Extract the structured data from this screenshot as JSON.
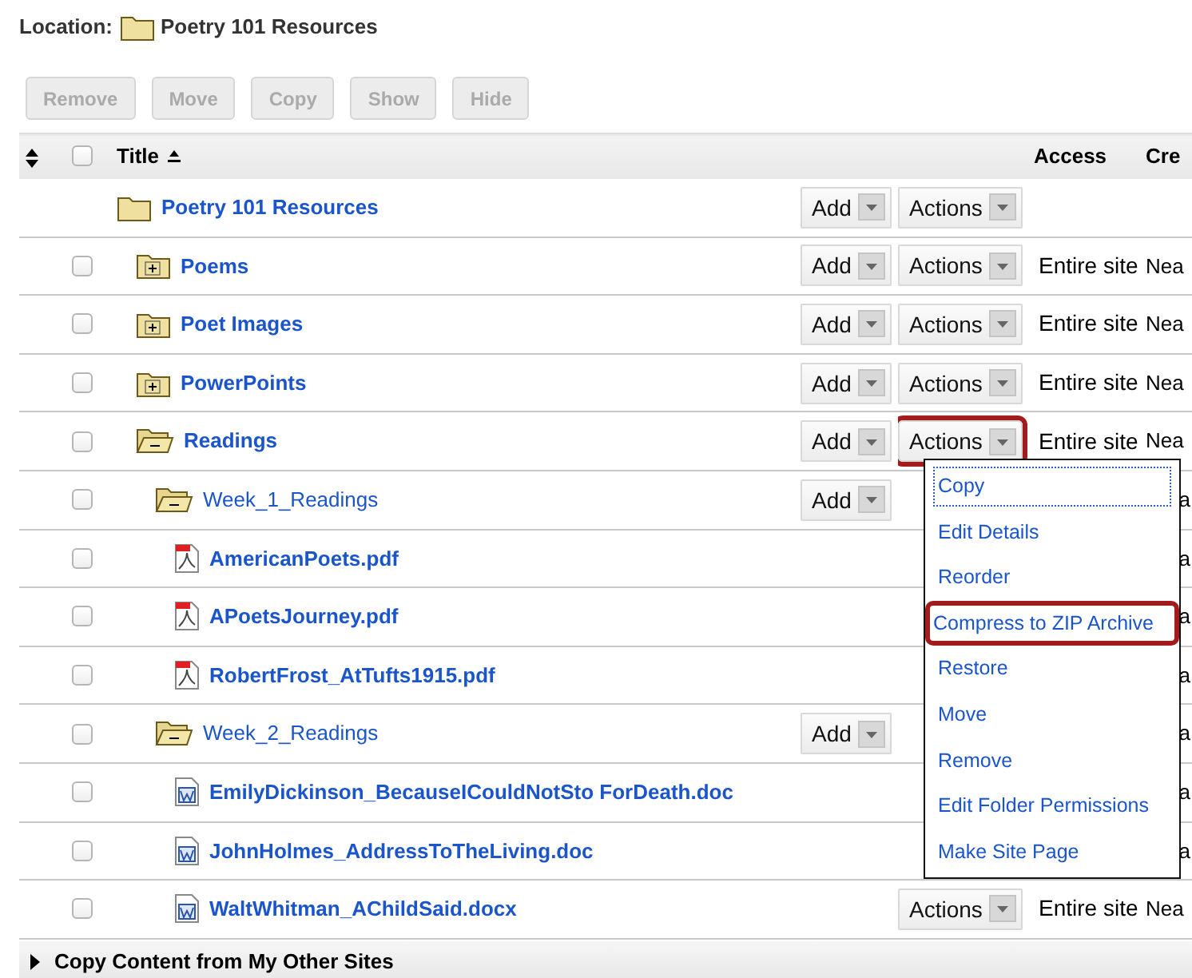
{
  "location": {
    "label": "Location:",
    "folder": "Poetry 101 Resources"
  },
  "toolbar": [
    {
      "label": "Remove",
      "disabled": true
    },
    {
      "label": "Move",
      "disabled": true
    },
    {
      "label": "Copy",
      "disabled": true
    },
    {
      "label": "Show",
      "disabled": true
    },
    {
      "label": "Hide",
      "disabled": true
    }
  ],
  "table": {
    "columns": {
      "select_all_checked": false,
      "title": "Title",
      "access": "Access",
      "creator": "Cre"
    },
    "root": {
      "title": "Poetry 101 Resources",
      "kind": "root",
      "bold": true,
      "add": "Add",
      "actions": "Actions",
      "children": [
        {
          "title": "Poems",
          "kind": "folder",
          "expanded": false,
          "bold": true,
          "checked": false,
          "add": "Add",
          "actions": "Actions",
          "access": "Entire site",
          "creator": "Nea"
        },
        {
          "title": "Poet Images",
          "kind": "folder",
          "expanded": false,
          "bold": true,
          "checked": false,
          "add": "Add",
          "actions": "Actions",
          "access": "Entire site",
          "creator": "Nea"
        },
        {
          "title": "PowerPoints",
          "kind": "folder",
          "expanded": false,
          "bold": true,
          "checked": false,
          "add": "Add",
          "actions": "Actions",
          "access": "Entire site",
          "creator": "Nea"
        },
        {
          "title": "Readings",
          "kind": "folder",
          "expanded": true,
          "bold": true,
          "checked": false,
          "add": "Add",
          "actions": "Actions",
          "actions_highlighted": true,
          "access": "Entire site",
          "creator": "Nea",
          "children": [
            {
              "title": "Week_1_Readings",
              "kind": "folder",
              "expanded": true,
              "bold": false,
              "checked": false,
              "add": "Add",
              "creator": "a",
              "creator_partial": true,
              "children": [
                {
                  "title": "AmericanPoets.pdf",
                  "kind": "pdf",
                  "bold": true,
                  "checked": false,
                  "creator": "a",
                  "creator_partial": true
                },
                {
                  "title": "APoetsJourney.pdf",
                  "kind": "pdf",
                  "bold": true,
                  "checked": false,
                  "creator": "a",
                  "creator_partial": true
                },
                {
                  "title": "RobertFrost_AtTufts1915.pdf",
                  "kind": "pdf",
                  "bold": true,
                  "checked": false,
                  "creator": "a",
                  "creator_partial": true
                }
              ]
            },
            {
              "title": "Week_2_Readings",
              "kind": "folder",
              "expanded": true,
              "bold": false,
              "checked": false,
              "add": "Add",
              "creator": "a",
              "creator_partial": true,
              "children": [
                {
                  "title": "EmilyDickinson_BecauseICouldNotSto ForDeath.doc",
                  "kind": "doc",
                  "bold": true,
                  "checked": false,
                  "creator": "a",
                  "creator_partial": true
                },
                {
                  "title": "JohnHolmes_AddressToTheLiving.doc",
                  "kind": "doc",
                  "bold": true,
                  "checked": false,
                  "creator": "a",
                  "creator_partial": true
                },
                {
                  "title": "WaltWhitman_AChildSaid.docx",
                  "kind": "doc",
                  "bold": true,
                  "checked": false,
                  "actions": "Actions",
                  "access": "Entire site",
                  "creator": "Nea"
                }
              ]
            }
          ]
        }
      ]
    }
  },
  "actions_menu": [
    {
      "label": "Copy",
      "focused": true,
      "highlighted": false
    },
    {
      "label": "Edit Details",
      "focused": false,
      "highlighted": false
    },
    {
      "label": "Reorder",
      "focused": false,
      "highlighted": false
    },
    {
      "label": "Compress to ZIP Archive",
      "focused": false,
      "highlighted": true
    },
    {
      "label": "Restore",
      "focused": false,
      "highlighted": false
    },
    {
      "label": "Move",
      "focused": false,
      "highlighted": false
    },
    {
      "label": "Remove",
      "focused": false,
      "highlighted": false
    },
    {
      "label": "Edit Folder Permissions",
      "focused": false,
      "highlighted": false
    },
    {
      "label": "Make Site Page",
      "focused": false,
      "highlighted": false
    }
  ],
  "footer": {
    "label": "Copy Content from My Other Sites",
    "expanded": false
  }
}
